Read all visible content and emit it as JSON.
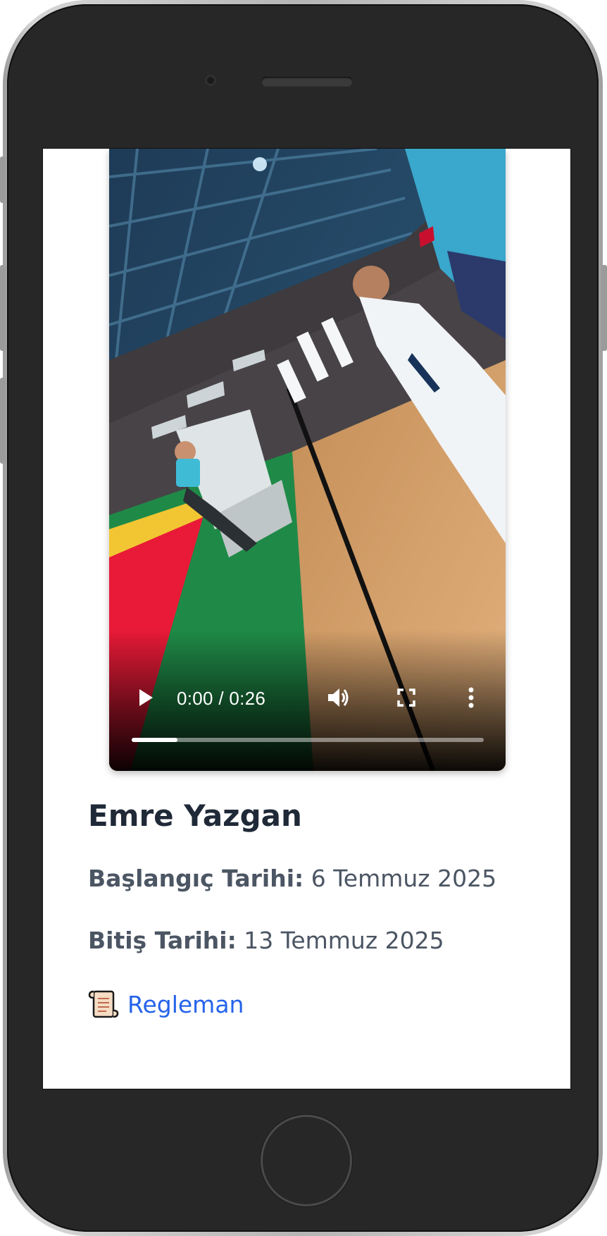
{
  "video": {
    "time_display": "0:00 / 0:26",
    "progress_fraction": 0.13,
    "play_icon": "play-icon",
    "volume_icon": "volume-icon",
    "fullscreen_icon": "fullscreen-icon",
    "more_icon": "more-options-icon"
  },
  "profile": {
    "name": "Emre Yazgan",
    "start_label": "Başlangıç Tarihi:",
    "start_value": "6 Temmuz 2025",
    "end_label": "Bitiş Tarihi:",
    "end_value": "13 Temmuz 2025",
    "rules_link": "Regleman"
  },
  "colors": {
    "name_text": "#1f2937",
    "detail_text": "#4b5563",
    "link": "#2563eb",
    "phone_body": "#272727"
  }
}
